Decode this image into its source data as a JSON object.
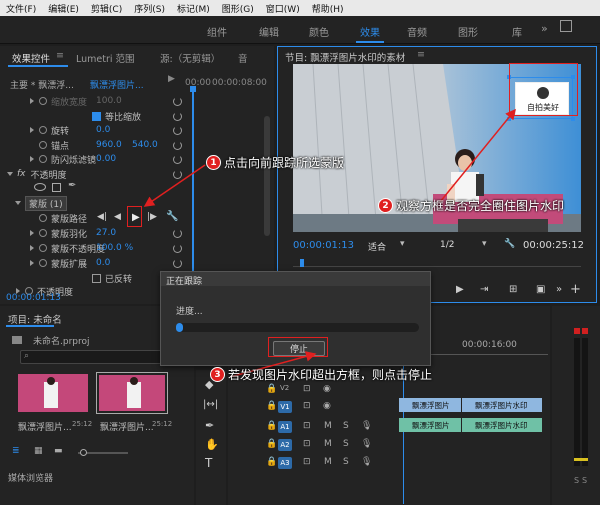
{
  "menu": [
    "文件(F)",
    "编辑(E)",
    "剪辑(C)",
    "序列(S)",
    "标记(M)",
    "图形(G)",
    "窗口(W)",
    "帮助(H)"
  ],
  "workspaces": [
    {
      "label": "组件",
      "active": false
    },
    {
      "label": "编辑",
      "active": false
    },
    {
      "label": "颜色",
      "active": false
    },
    {
      "label": "效果",
      "active": true
    },
    {
      "label": "音频",
      "active": false
    },
    {
      "label": "图形",
      "active": false
    },
    {
      "label": "库",
      "active": false
    }
  ],
  "effect_controls": {
    "tabs": [
      "效果控件",
      "Lumetri 范围",
      "源:（无剪辑）",
      "音"
    ],
    "master": "主要 * 飘漂浮...",
    "clip": "飘漂浮图片...",
    "tc_start": "00:00",
    "tc_end": "00:00:08:00",
    "rows": [
      {
        "label": "缩放宽度",
        "value": "100.0"
      },
      {
        "label": "等比缩放",
        "value": ""
      },
      {
        "label": "旋转",
        "value": "0.0"
      },
      {
        "label": "锚点",
        "value": "960.0",
        "value2": "540.0"
      },
      {
        "label": "防闪烁滤镜",
        "value": "0.00"
      },
      {
        "label": "不透明度",
        "value": ""
      },
      {
        "label": "蒙版 (1)",
        "value": ""
      },
      {
        "label": "蒙版路径",
        "value": ""
      },
      {
        "label": "蒙版羽化",
        "value": "27.0"
      },
      {
        "label": "蒙版不透明度",
        "value": "100.0 %"
      },
      {
        "label": "蒙版扩展",
        "value": "0.0"
      },
      {
        "label": "已反转",
        "value": ""
      },
      {
        "label": "不透明度",
        "value": ""
      }
    ],
    "timecode": "00:00:01:13"
  },
  "program": {
    "title": "节目: 飘漂浮图片水印的素材",
    "watermark": "自拍美好",
    "timecode": "00:00:01:13",
    "fit": "适合",
    "res": "1/2",
    "duration": "00:00:25:12"
  },
  "project": {
    "title": "项目: 未命名",
    "file": "未命名.prproj",
    "clips": [
      {
        "name": "飘漂浮图片...",
        "dur": "25:12"
      },
      {
        "name": "飘漂浮图片...",
        "dur": "25:12"
      }
    ],
    "browser": "媒体浏览器"
  },
  "dialog": {
    "title": "正在跟踪",
    "progress_label": "进度...",
    "stop": "停止",
    "progress": 0.03
  },
  "timeline": {
    "timecode": "00:00:16:00",
    "tracks": [
      "V2",
      "V1",
      "A1",
      "A2",
      "A3"
    ],
    "clip_v2": "飘漂浮图片",
    "clip_v2b": "飘漂浮图片水印",
    "clip_v1": "飘漂浮图片",
    "clip_v1b": "飘漂浮图片水印"
  },
  "callouts": [
    {
      "num": "1",
      "text": "点击向前跟踪所选蒙版"
    },
    {
      "num": "2",
      "text": "观察方框是否完全圈住图片水印"
    },
    {
      "num": "3",
      "text": "若发现图片水印超出方框，则点击停止"
    }
  ],
  "colors": {
    "accent": "#2d8ceb",
    "annotation": "#e02020"
  }
}
